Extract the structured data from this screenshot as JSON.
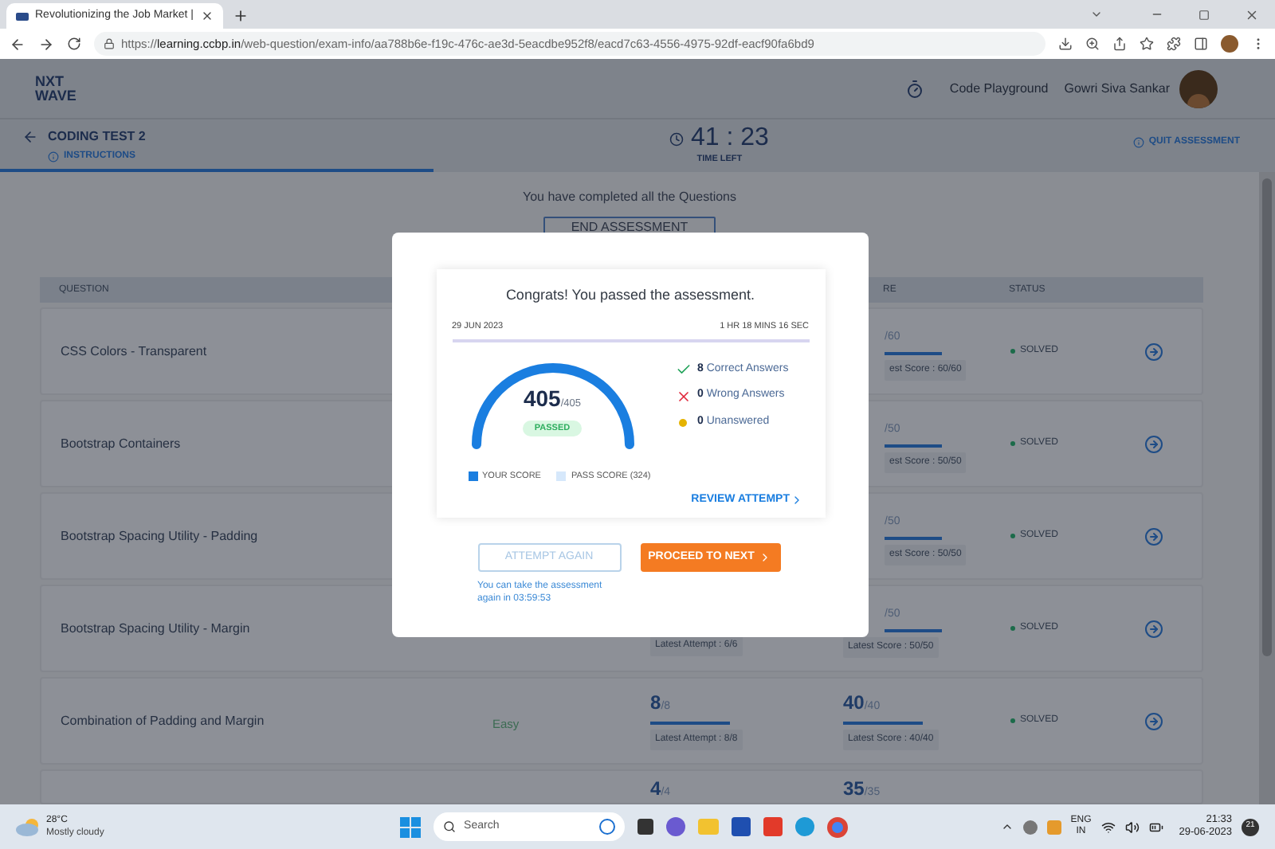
{
  "browser": {
    "tab_title": "Revolutionizing the Job Market |",
    "url_scheme": "https://",
    "url_host": "learning.ccbp.in",
    "url_path": "/web-question/exam-info/aa788b6e-f19c-476c-ae3d-5eacdbe952f8/eacd7c63-4556-4975-92df-eacf90fa6bd9"
  },
  "header": {
    "logo": [
      "NXT",
      "WAVE"
    ],
    "code_playground": "Code Playground",
    "user_name": "Gowri Siva Sankar"
  },
  "subheader": {
    "title": "CODING TEST 2",
    "instructions": "INSTRUCTIONS",
    "timer": "41 : 23",
    "timer_label": "TIME LEFT",
    "quit": "QUIT ASSESSMENT"
  },
  "completion_message": "You have completed all the Questions",
  "end_button": "END ASSESSMENT",
  "table": {
    "columns": [
      {
        "label": "QUESTION",
        "kind": "question"
      },
      {
        "label": "RE",
        "kind": "score"
      },
      {
        "label": "STATUS",
        "kind": "status"
      }
    ],
    "rows": [
      {
        "question": "CSS Colors - Transparent",
        "score": "/60",
        "score_cut": true,
        "score_note": "est Score : 60/60",
        "note_cut": true,
        "status": "SOLVED"
      },
      {
        "question": "Bootstrap Containers",
        "score": "/50",
        "score_cut": true,
        "score_note": "est Score : 50/50",
        "note_cut": true,
        "status": "SOLVED"
      },
      {
        "question": "Bootstrap Spacing Utility - Padding",
        "score": "/50",
        "score_cut": true,
        "score_note": "est Score : 50/50",
        "note_cut": true,
        "status": "SOLVED"
      },
      {
        "question": "Bootstrap Spacing Utility - Margin",
        "attempt_note": "Latest Attempt : 6/6",
        "score": "/50",
        "score_cut": true,
        "score_note": "Latest Score : 50/50",
        "status": "SOLVED"
      },
      {
        "question": "Combination of Padding and Margin",
        "difficulty": "Easy",
        "attempts": "8",
        "attempts_total": "/8",
        "attempt_note": "Latest Attempt : 8/8",
        "score": "40",
        "score_total": "/40",
        "score_note": "Latest Score : 40/40",
        "status": "SOLVED"
      },
      {
        "question": "",
        "attempts": "4",
        "attempts_total": "/4",
        "score": "35",
        "score_total": "/35",
        "partial": true
      }
    ]
  },
  "modal": {
    "title": "Congrats! You passed the assessment.",
    "date": "29 JUN 2023",
    "duration": "1 HR 18 MINS 16 SEC",
    "score": "405",
    "total": "/405",
    "badge": "PASSED",
    "stats": [
      {
        "kind": "correct",
        "count": "8",
        "label": "Correct Answers"
      },
      {
        "kind": "wrong",
        "count": "0",
        "label": "Wrong Answers"
      },
      {
        "kind": "unanswered",
        "count": "0",
        "label": "Unanswered"
      }
    ],
    "legend": [
      {
        "kind": "yours",
        "label": "YOUR SCORE"
      },
      {
        "kind": "pass",
        "label": "PASS SCORE (324)"
      }
    ],
    "review": "REVIEW ATTEMPT",
    "attempt_again": {
      "label": "ATTEMPT AGAIN",
      "disabled": true
    },
    "proceed": "PROCEED TO NEXT",
    "note": "You can take the assessment again in 03:59:53"
  },
  "taskbar": {
    "temperature": "28°C",
    "weather": "Mostly cloudy",
    "search_placeholder": "Search",
    "language": [
      "ENG",
      "IN"
    ],
    "time": "21:33",
    "date": "29-06-2023",
    "notifications": "21"
  }
}
